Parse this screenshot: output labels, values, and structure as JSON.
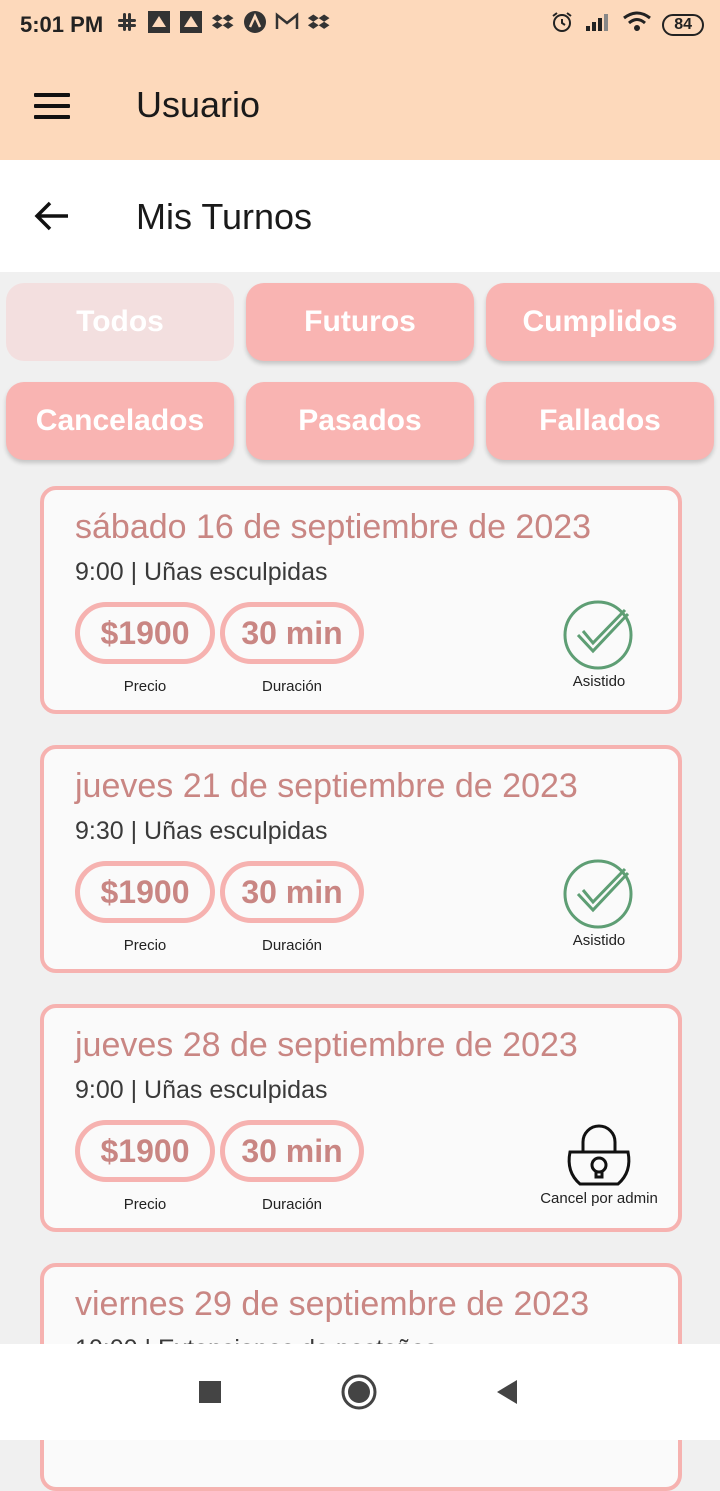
{
  "status_bar": {
    "time": "5:01 PM",
    "battery": "84"
  },
  "app_bar": {
    "title": "Usuario"
  },
  "sub_bar": {
    "title": "Mis Turnos"
  },
  "filters": [
    {
      "label": "Todos",
      "active": true
    },
    {
      "label": "Futuros",
      "active": false
    },
    {
      "label": "Cumplidos",
      "active": false
    },
    {
      "label": "Cancelados",
      "active": false
    },
    {
      "label": "Pasados",
      "active": false
    },
    {
      "label": "Fallados",
      "active": false
    }
  ],
  "appointments": [
    {
      "date": "sábado 16 de septiembre de 2023",
      "time_service": "9:00 | Uñas esculpidas",
      "price": "$1900",
      "price_label": "Precio",
      "duration": "30 min",
      "duration_label": "Duración",
      "status": "Asistido",
      "status_icon": "check-circle-icon"
    },
    {
      "date": "jueves 21 de septiembre de 2023",
      "time_service": "9:30 | Uñas esculpidas",
      "price": "$1900",
      "price_label": "Precio",
      "duration": "30 min",
      "duration_label": "Duración",
      "status": "Asistido",
      "status_icon": "check-circle-icon"
    },
    {
      "date": "jueves 28 de septiembre de 2023",
      "time_service": "9:00 | Uñas esculpidas",
      "price": "$1900",
      "price_label": "Precio",
      "duration": "30 min",
      "duration_label": "Duración",
      "status": "Cancel por admin",
      "status_icon": "lock-icon"
    },
    {
      "date": "viernes 29 de septiembre de 2023",
      "time_service": "10:00 | Extensiones de pestañas"
    }
  ],
  "colors": {
    "accent": "#fdd9bb",
    "pink": "#f9b4b2",
    "text_pink": "#c98683",
    "check_green": "#5e9e74"
  }
}
